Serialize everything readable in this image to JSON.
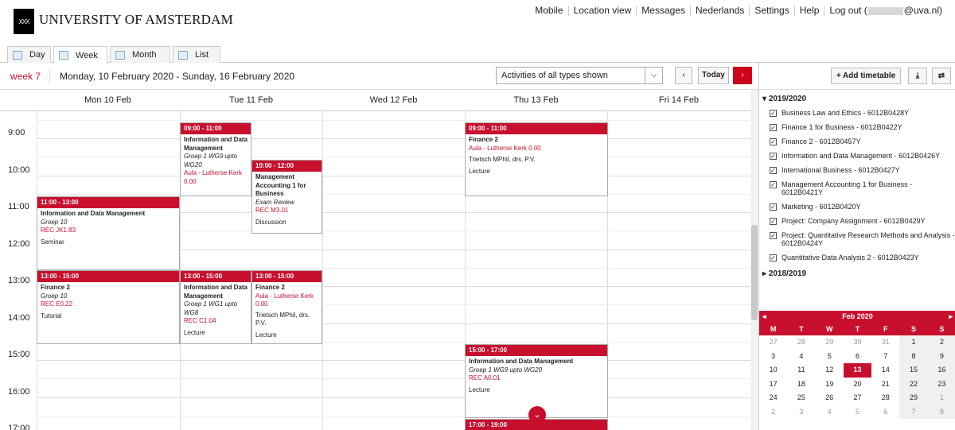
{
  "brand": {
    "logo_text": "XXX",
    "title": "UNIVERSITY OF AMSTERDAM"
  },
  "topnav": {
    "mobile": "Mobile",
    "location": "Location view",
    "messages": "Messages",
    "lang": "Nederlands",
    "settings": "Settings",
    "help": "Help",
    "logout_prefix": "Log out (",
    "logout_suffix": "@uva.nl)"
  },
  "tabs": {
    "day": "Day",
    "week": "Week",
    "month": "Month",
    "list": "List"
  },
  "toolbar": {
    "week": "week 7",
    "range": "Monday, 10 February 2020 - Sunday, 16 February 2020",
    "filter": "Activities of all types shown",
    "today": "Today",
    "prev": "‹",
    "next": "›"
  },
  "days": {
    "mon": "Mon 10 Feb",
    "tue": "Tue 11 Feb",
    "wed": "Wed 12 Feb",
    "thu": "Thu 13 Feb",
    "fri": "Fri 14 Feb"
  },
  "times": {
    "t9": "9:00",
    "t10": "10:00",
    "t11": "11:00",
    "t12": "12:00",
    "t13": "13:00",
    "t14": "14:00",
    "t15": "15:00",
    "t16": "16:00",
    "t17": "17:00"
  },
  "events": {
    "tue1": {
      "time": "09:00 - 11:00",
      "title": "Information and Data Management",
      "group": "Groep 1 WG9 upto WG20",
      "room": "Aula - Lutherse Kerk 0.00"
    },
    "tue2": {
      "time": "10:00 - 12:00",
      "title": "Management Accounting 1 for Business",
      "group": "Exam Review",
      "room": "REC M3.01",
      "kind": "Discussion"
    },
    "mon1": {
      "time": "11:00 - 13:00",
      "title": "Information and Data Management",
      "group": "Groep 10",
      "room": "REC JK1.83",
      "kind": "Seminar"
    },
    "mon2": {
      "time": "13:00 - 15:00",
      "title": "Finance 2",
      "group": "Groep 10",
      "room": "REC E0.22",
      "kind": "Tutorial"
    },
    "tue3": {
      "time": "13:00 - 15:00",
      "title": "Information and Data Management",
      "group": "Groep 1 WG1 upto WG8",
      "room": "REC C1.04",
      "kind": "Lecture"
    },
    "tue4": {
      "time": "13:00 - 15:00",
      "title": "Finance 2",
      "room": "Aula - Lutherse Kerk 0.00",
      "teacher": "Trietsch MPhil, drs. P.V.",
      "kind": "Lecture"
    },
    "thu1": {
      "time": "09:00 - 11:00",
      "title": "Finance 2",
      "room": "Aula - Lutherse Kerk 0.00",
      "teacher": "Trietsch MPhil, drs. P.V.",
      "kind": "Lecture"
    },
    "thu2": {
      "time": "15:00 - 17:00",
      "title": "Information and Data Management",
      "group": "Groep 1 WG9 upto WG20",
      "room": "REC A0.01",
      "kind": "Lecture"
    },
    "thu3": {
      "time": "17:00 - 19:00"
    }
  },
  "sidebar": {
    "add": "+ Add timetable",
    "y2019": "2019/2020",
    "y2018": "2018/2019",
    "courses": [
      "Business Law and Ethics - 6012B0428Y",
      "Finance 1 for Business - 6012B0422Y",
      "Finance 2 - 6012B0457Y",
      "Information and Data Management - 6012B0426Y",
      "International Business - 6012B0427Y",
      "Management Accounting 1 for Business - 6012B0421Y",
      "Marketing - 6012B0420Y",
      "Project: Company Assignment - 6012B0429Y",
      "Project: Quantitative Research Methods and Analysis - 6012B0424Y",
      "Quantitative Data Analysis 2 - 6012B0423Y"
    ]
  },
  "minical": {
    "month": "Feb 2020",
    "heads": [
      "M",
      "T",
      "W",
      "T",
      "F",
      "S",
      "S"
    ],
    "rows": [
      [
        "27",
        "28",
        "29",
        "30",
        "31",
        "1",
        "2"
      ],
      [
        "3",
        "4",
        "5",
        "6",
        "7",
        "8",
        "9"
      ],
      [
        "10",
        "11",
        "12",
        "13",
        "14",
        "15",
        "16"
      ],
      [
        "17",
        "18",
        "19",
        "20",
        "21",
        "22",
        "23"
      ],
      [
        "24",
        "25",
        "26",
        "27",
        "28",
        "29",
        "1"
      ],
      [
        "2",
        "3",
        "4",
        "5",
        "6",
        "7",
        "8"
      ]
    ],
    "today": "13"
  },
  "colors": {
    "accent": "#c8102e"
  }
}
